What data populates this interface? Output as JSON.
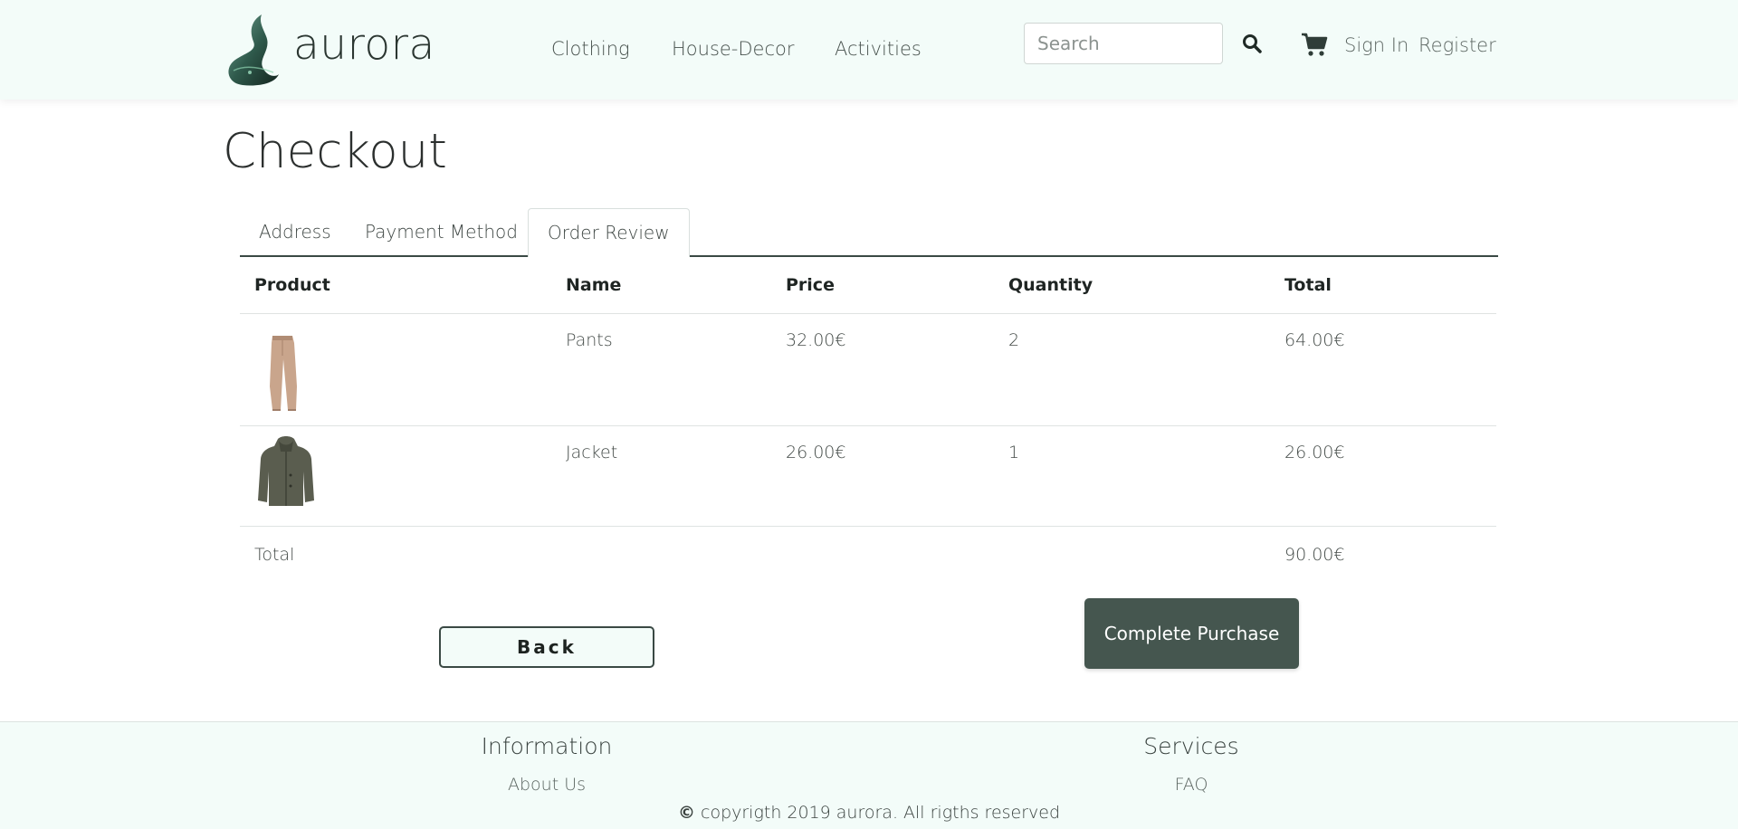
{
  "header": {
    "brand": "aurora",
    "nav": [
      {
        "label": "Clothing"
      },
      {
        "label": "House-Decor"
      },
      {
        "label": "Activities"
      }
    ],
    "search": {
      "placeholder": "Search",
      "value": ""
    },
    "sign_in": "Sign In",
    "register": "Register",
    "icons": {
      "search": "search-icon",
      "cart": "cart-icon"
    }
  },
  "main": {
    "title": "Checkout",
    "tabs": [
      {
        "label": "Address",
        "active": false
      },
      {
        "label": "Payment Method",
        "active": false
      },
      {
        "label": "Order Review",
        "active": true
      }
    ],
    "table": {
      "headers": [
        "Product",
        "Name",
        "Price",
        "Quantity",
        "Total"
      ],
      "rows": [
        {
          "image": "pants-image",
          "name": "Pants",
          "price": "32.00€",
          "quantity": "2",
          "total": "64.00€"
        },
        {
          "image": "jacket-image",
          "name": "Jacket",
          "price": "26.00€",
          "quantity": "1",
          "total": "26.00€"
        }
      ],
      "total_label": "Total",
      "total_value": "90.00€"
    },
    "back_label": "Back",
    "complete_label": "Complete Purchase"
  },
  "footer": {
    "info_heading": "Information",
    "about_link": "About Us",
    "services_heading": "Services",
    "faq_link": "FAQ",
    "copyright_symbol": "©",
    "copyright": "copyrigth 2019 aurora. All rigths reserved"
  },
  "colors": {
    "accent": "#45564f",
    "header_bg": "#f3fcf9",
    "border_dark": "#3a4944"
  }
}
